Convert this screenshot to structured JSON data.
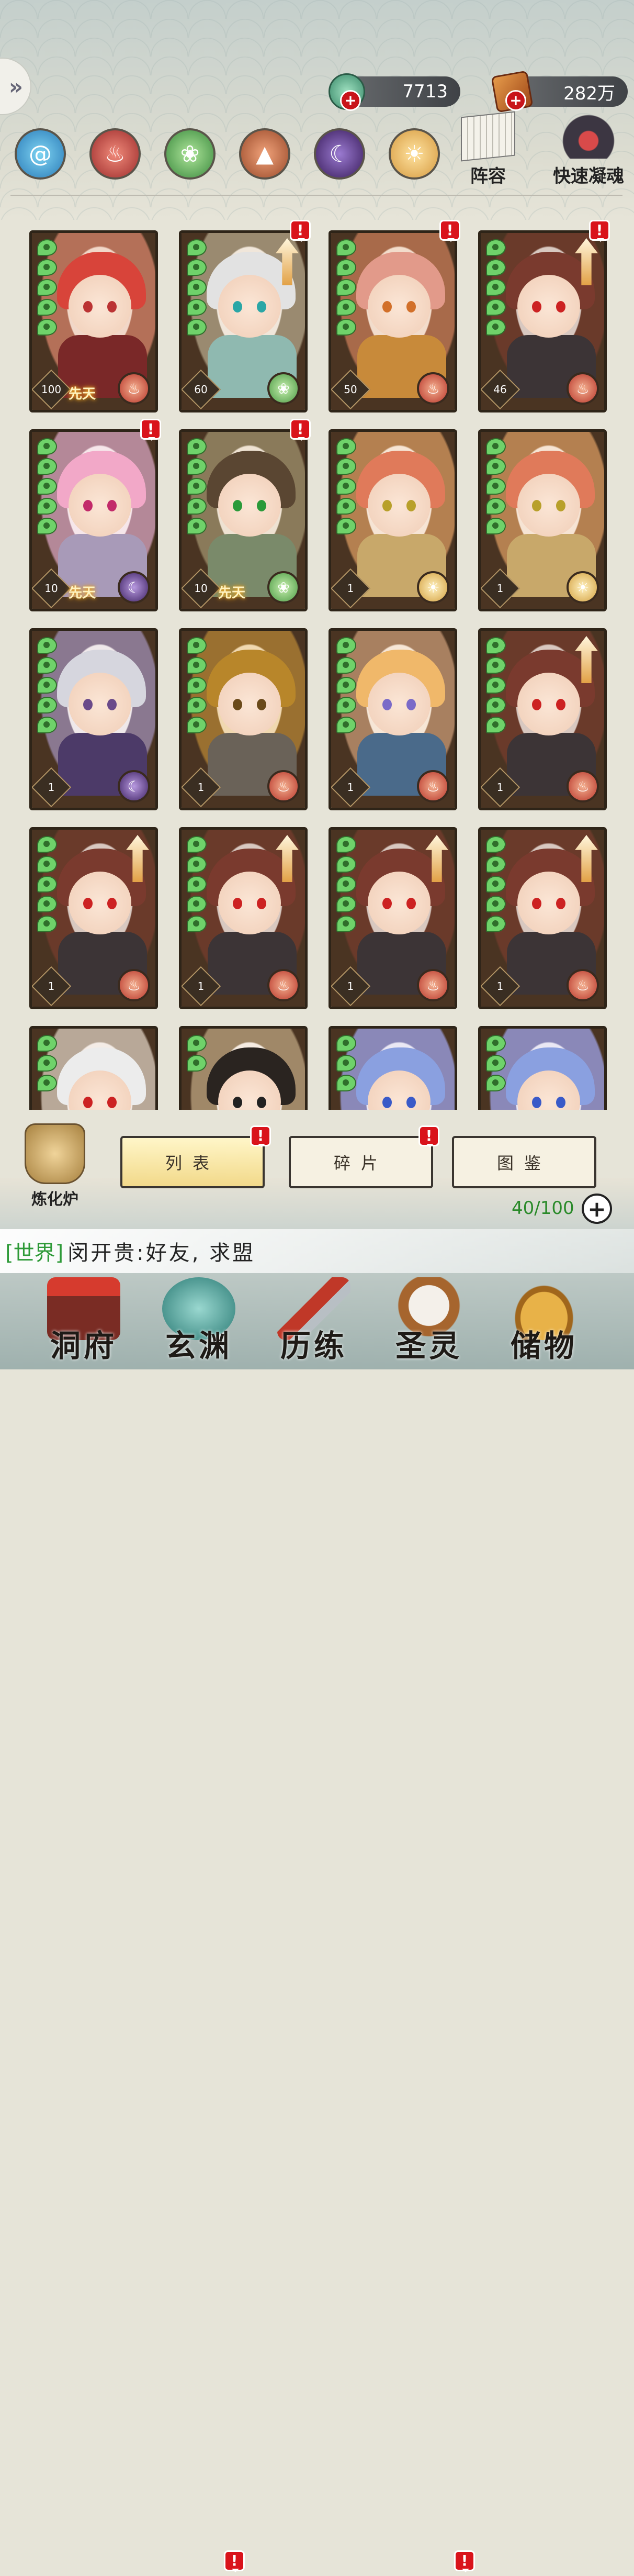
{
  "header": {
    "back_icon": "double-chevron-left-icon",
    "currencies": [
      {
        "name": "jade",
        "value": "7713",
        "icon": "jade-coin-icon"
      },
      {
        "name": "scroll",
        "value": "282万",
        "icon": "scroll-token-icon"
      }
    ],
    "add_symbol": "+"
  },
  "element_filters": [
    {
      "id": "water",
      "icon": "water-swirl-icon",
      "glyph": "@"
    },
    {
      "id": "fire",
      "icon": "flame-icon",
      "glyph": "♨"
    },
    {
      "id": "wind",
      "icon": "wind-icon",
      "glyph": "❀"
    },
    {
      "id": "earth",
      "icon": "mountain-icon",
      "glyph": "▲"
    },
    {
      "id": "dark",
      "icon": "crescent-icon",
      "glyph": "☾"
    },
    {
      "id": "light",
      "icon": "sun-icon",
      "glyph": "☀"
    }
  ],
  "top_buttons": {
    "lineup": "阵容",
    "quick_soul": "快速凝魂"
  },
  "cards": [
    {
      "level": "100",
      "innate": "先天",
      "element": "fire",
      "pips": 5,
      "alert": false,
      "upgrade": false,
      "hair": "#d8443a",
      "cloth": "#7a2828",
      "c1": "#f1d7c8",
      "c2": "#b47058",
      "eye": "#b33"
    },
    {
      "level": "60",
      "innate": "",
      "element": "wind",
      "pips": 5,
      "alert": true,
      "upgrade": true,
      "hair": "#e2e2e2",
      "cloth": "#8fb9b0",
      "c1": "#f0e6da",
      "c2": "#9a8a70",
      "eye": "#2aa6a6"
    },
    {
      "level": "50",
      "innate": "",
      "element": "fire",
      "pips": 5,
      "alert": true,
      "upgrade": false,
      "hair": "#e29a8a",
      "cloth": "#c88a3a",
      "c1": "#f2dccb",
      "c2": "#a86a4a",
      "eye": "#d2702a"
    },
    {
      "level": "46",
      "innate": "",
      "element": "fire",
      "pips": 5,
      "alert": true,
      "upgrade": true,
      "hair": "#7a3a2e",
      "cloth": "#3c3436",
      "c1": "#d8c8c0",
      "c2": "#6a3a2a",
      "eye": "#c22"
    },
    {
      "level": "10",
      "innate": "先天",
      "element": "dark",
      "pips": 5,
      "alert": true,
      "upgrade": false,
      "hair": "#f2a8c8",
      "cloth": "#a89ab8",
      "c1": "#f6e6ea",
      "c2": "#b48898",
      "eye": "#c22a6a"
    },
    {
      "level": "10",
      "innate": "先天",
      "element": "wind",
      "pips": 5,
      "alert": true,
      "upgrade": false,
      "hair": "#5a4632",
      "cloth": "#7a8a6a",
      "c1": "#eee2d2",
      "c2": "#8a7a5a",
      "eye": "#2a9a3a"
    },
    {
      "level": "1",
      "innate": "",
      "element": "light",
      "pips": 5,
      "alert": false,
      "upgrade": false,
      "hair": "#e07a5a",
      "cloth": "#c8a86a",
      "c1": "#f6e4d4",
      "c2": "#b48050",
      "eye": "#b8a02a"
    },
    {
      "level": "1",
      "innate": "",
      "element": "light",
      "pips": 5,
      "alert": false,
      "upgrade": false,
      "hair": "#e07a5a",
      "cloth": "#c8a86a",
      "c1": "#f6e4d4",
      "c2": "#b48050",
      "eye": "#b8a02a"
    },
    {
      "level": "1",
      "innate": "",
      "element": "dark",
      "pips": 5,
      "alert": false,
      "upgrade": false,
      "hair": "#d6d6de",
      "cloth": "#4c3a68",
      "c1": "#efe8ea",
      "c2": "#8a7890",
      "eye": "#6a4a8a"
    },
    {
      "level": "1",
      "innate": "",
      "element": "fire",
      "pips": 5,
      "alert": false,
      "upgrade": false,
      "hair": "#b8862a",
      "cloth": "#6a6258",
      "c1": "#f0d8b0",
      "c2": "#9a7030",
      "eye": "#6a4a1a"
    },
    {
      "level": "1",
      "innate": "",
      "element": "fire",
      "pips": 5,
      "alert": false,
      "upgrade": false,
      "hair": "#f0b86a",
      "cloth": "#4a6a8a",
      "c1": "#f6e6d6",
      "c2": "#a88060",
      "eye": "#7a6ac8"
    },
    {
      "level": "1",
      "innate": "",
      "element": "fire",
      "pips": 5,
      "alert": false,
      "upgrade": true,
      "hair": "#7a3a2e",
      "cloth": "#3c3436",
      "c1": "#d8c8c0",
      "c2": "#6a3a2a",
      "eye": "#c22"
    },
    {
      "level": "1",
      "innate": "",
      "element": "fire",
      "pips": 5,
      "alert": false,
      "upgrade": true,
      "hair": "#7a3a2e",
      "cloth": "#3c3436",
      "c1": "#d8c8c0",
      "c2": "#6a3a2a",
      "eye": "#c22"
    },
    {
      "level": "1",
      "innate": "",
      "element": "fire",
      "pips": 5,
      "alert": false,
      "upgrade": true,
      "hair": "#7a3a2e",
      "cloth": "#3c3436",
      "c1": "#d8c8c0",
      "c2": "#6a3a2a",
      "eye": "#c22"
    },
    {
      "level": "1",
      "innate": "",
      "element": "fire",
      "pips": 5,
      "alert": false,
      "upgrade": true,
      "hair": "#7a3a2e",
      "cloth": "#3c3436",
      "c1": "#d8c8c0",
      "c2": "#6a3a2a",
      "eye": "#c22"
    },
    {
      "level": "1",
      "innate": "",
      "element": "fire",
      "pips": 5,
      "alert": false,
      "upgrade": true,
      "hair": "#7a3a2e",
      "cloth": "#3c3436",
      "c1": "#d8c8c0",
      "c2": "#6a3a2a",
      "eye": "#c22"
    },
    {
      "level": "",
      "innate": "",
      "element": "",
      "pips": 3,
      "alert": false,
      "upgrade": false,
      "hair": "#ececec",
      "cloth": "#c8c0c0",
      "c1": "#f4ece6",
      "c2": "#b8a898",
      "eye": "#c22"
    },
    {
      "level": "",
      "innate": "",
      "element": "",
      "pips": 2,
      "alert": false,
      "upgrade": false,
      "hair": "#2a2420",
      "cloth": "#5ac8d8",
      "c1": "#f6ece2",
      "c2": "#a08868",
      "eye": "#222"
    },
    {
      "level": "",
      "innate": "",
      "element": "",
      "pips": 3,
      "alert": false,
      "upgrade": false,
      "hair": "#8aa0e0",
      "cloth": "#4a5a9a",
      "c1": "#eae8f4",
      "c2": "#8a88b8",
      "eye": "#3a5ac8"
    },
    {
      "level": "",
      "innate": "",
      "element": "",
      "pips": 3,
      "alert": false,
      "upgrade": false,
      "hair": "#8aa0e0",
      "cloth": "#4a5a9a",
      "c1": "#eae8f4",
      "c2": "#8a88b8",
      "eye": "#3a5ac8"
    }
  ],
  "tabs": {
    "furnace_label": "炼化炉",
    "items": [
      {
        "id": "list",
        "label": "列表",
        "active": true,
        "alert": true
      },
      {
        "id": "fragments",
        "label": "碎片",
        "active": false,
        "alert": true
      },
      {
        "id": "codex",
        "label": "图鉴",
        "active": false,
        "alert": false
      }
    ],
    "alert_symbol": "!"
  },
  "capacity": {
    "text": "40/100",
    "plus": "+"
  },
  "chat": {
    "channel": "[世界]",
    "message": "闵开贵:好友, 求盟"
  },
  "bottom_nav": [
    {
      "id": "home",
      "label": "洞府",
      "alert": false
    },
    {
      "id": "abyss",
      "label": "玄渊",
      "alert": true
    },
    {
      "id": "train",
      "label": "历练",
      "alert": false
    },
    {
      "id": "spirit",
      "label": "圣灵",
      "alert": true
    },
    {
      "id": "storage",
      "label": "储物",
      "alert": false
    }
  ]
}
